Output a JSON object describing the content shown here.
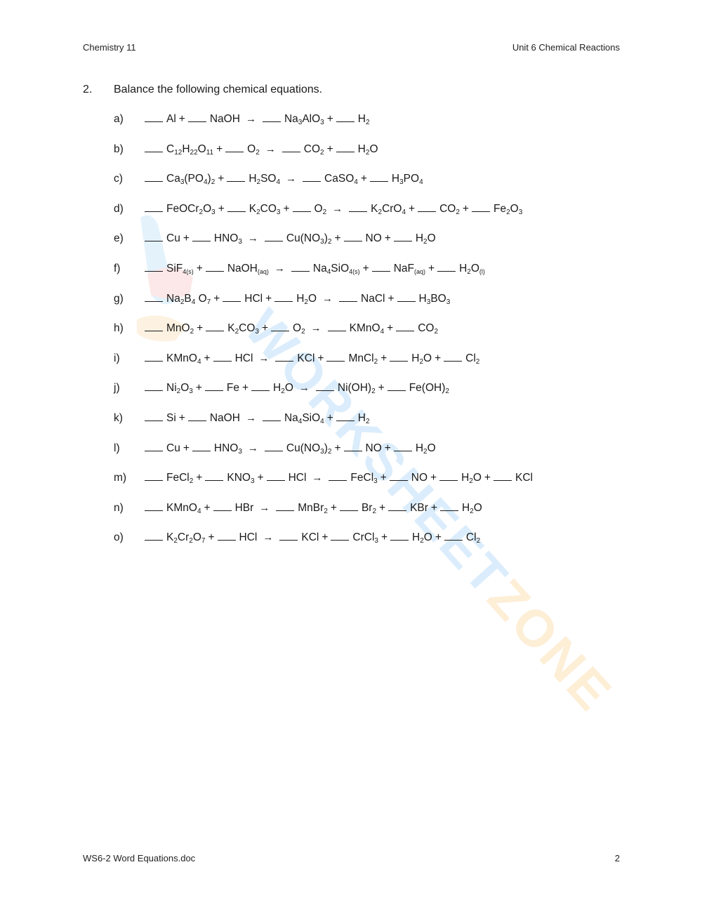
{
  "header": {
    "left": "Chemistry 11",
    "right": "Unit 6 Chemical Reactions"
  },
  "footer": {
    "left": "WS6-2 Word Equations.doc",
    "right": "2"
  },
  "question": {
    "number": "2.",
    "prompt": "Balance the following chemical equations."
  },
  "symbols": {
    "plus": "+",
    "arrow": "→"
  },
  "watermark": {
    "text": "WORKSHEETZONE",
    "colors": [
      "#cfe8fb",
      "#fbd6d6",
      "#fde9c9"
    ]
  },
  "equations": [
    {
      "label": "a)",
      "reactants": [
        [
          [
            "Al",
            ""
          ]
        ],
        [
          [
            "NaOH",
            ""
          ]
        ]
      ],
      "products": [
        [
          [
            "Na",
            "3"
          ],
          [
            "AlO",
            "3"
          ]
        ],
        [
          [
            "H",
            "2"
          ]
        ]
      ]
    },
    {
      "label": "b)",
      "reactants": [
        [
          [
            "C",
            "12"
          ],
          [
            "H",
            "22"
          ],
          [
            "O",
            "11"
          ]
        ],
        [
          [
            "O",
            "2"
          ]
        ]
      ],
      "products": [
        [
          [
            "CO",
            "2"
          ]
        ],
        [
          [
            "H",
            "2"
          ],
          [
            "O",
            ""
          ]
        ]
      ]
    },
    {
      "label": "c)",
      "reactants": [
        [
          [
            "Ca",
            "3"
          ],
          [
            "(PO",
            "4"
          ],
          [
            ")",
            "2"
          ]
        ],
        [
          [
            "H",
            "2"
          ],
          [
            "SO",
            "4"
          ]
        ]
      ],
      "products": [
        [
          [
            "CaSO",
            "4"
          ]
        ],
        [
          [
            "H",
            "3"
          ],
          [
            "PO",
            "4"
          ]
        ]
      ]
    },
    {
      "label": "d)",
      "reactants": [
        [
          [
            "FeOCr",
            "2"
          ],
          [
            "O",
            "3"
          ]
        ],
        [
          [
            "K",
            "2"
          ],
          [
            "CO",
            "3"
          ]
        ],
        [
          [
            "O",
            "2"
          ]
        ]
      ],
      "products": [
        [
          [
            "K",
            "2"
          ],
          [
            "CrO",
            "4"
          ]
        ],
        [
          [
            "CO",
            "2"
          ]
        ],
        [
          [
            "Fe",
            "2"
          ],
          [
            "O",
            "3"
          ]
        ]
      ]
    },
    {
      "label": "e)",
      "reactants": [
        [
          [
            "Cu",
            ""
          ]
        ],
        [
          [
            "HNO",
            "3"
          ]
        ]
      ],
      "products": [
        [
          [
            "Cu(NO",
            "3"
          ],
          [
            ")",
            "2"
          ]
        ],
        [
          [
            "NO",
            ""
          ]
        ],
        [
          [
            "H",
            "2"
          ],
          [
            "O",
            ""
          ]
        ]
      ]
    },
    {
      "label": "f)",
      "reactants": [
        [
          [
            "SiF",
            "4(s)"
          ]
        ],
        [
          [
            "NaOH",
            "(aq)"
          ]
        ]
      ],
      "products": [
        [
          [
            "Na",
            "4"
          ],
          [
            "SiO",
            "4(s)"
          ]
        ],
        [
          [
            "NaF",
            "(aq)"
          ]
        ],
        [
          [
            "H",
            "2"
          ],
          [
            "O",
            "(l)"
          ]
        ]
      ]
    },
    {
      "label": "g)",
      "reactants": [
        [
          [
            "Na",
            "2"
          ],
          [
            "B",
            "4"
          ],
          [
            " O",
            "7"
          ]
        ],
        [
          [
            "HCl",
            ""
          ]
        ],
        [
          [
            "H",
            "2"
          ],
          [
            "O",
            ""
          ]
        ]
      ],
      "products": [
        [
          [
            "NaCl",
            ""
          ]
        ],
        [
          [
            "H",
            "3"
          ],
          [
            "BO",
            "3"
          ]
        ]
      ]
    },
    {
      "label": "h)",
      "reactants": [
        [
          [
            "MnO",
            "2"
          ]
        ],
        [
          [
            "K",
            "2"
          ],
          [
            "CO",
            "3"
          ]
        ],
        [
          [
            "O",
            "2"
          ]
        ]
      ],
      "products": [
        [
          [
            "KMnO",
            "4"
          ]
        ],
        [
          [
            "CO",
            "2"
          ]
        ]
      ]
    },
    {
      "label": "i)",
      "reactants": [
        [
          [
            "KMnO",
            "4"
          ]
        ],
        [
          [
            "HCl",
            ""
          ]
        ]
      ],
      "products": [
        [
          [
            "KCl",
            ""
          ]
        ],
        [
          [
            "MnCl",
            "2"
          ]
        ],
        [
          [
            "H",
            "2"
          ],
          [
            "O",
            ""
          ]
        ],
        [
          [
            "Cl",
            "2"
          ]
        ]
      ]
    },
    {
      "label": "j)",
      "reactants": [
        [
          [
            "Ni",
            "2"
          ],
          [
            "O",
            "3"
          ]
        ],
        [
          [
            "Fe",
            ""
          ]
        ],
        [
          [
            "H",
            "2"
          ],
          [
            "O",
            ""
          ]
        ]
      ],
      "products": [
        [
          [
            "Ni(OH)",
            "2"
          ]
        ],
        [
          [
            "Fe(OH)",
            "2"
          ]
        ]
      ]
    },
    {
      "label": "k)",
      "reactants": [
        [
          [
            "Si",
            ""
          ]
        ],
        [
          [
            "NaOH",
            ""
          ]
        ]
      ],
      "products": [
        [
          [
            "Na",
            "4"
          ],
          [
            "SiO",
            "4"
          ]
        ],
        [
          [
            "H",
            "2"
          ]
        ]
      ]
    },
    {
      "label": "l)",
      "reactants": [
        [
          [
            "Cu",
            ""
          ]
        ],
        [
          [
            "HNO",
            "3"
          ]
        ]
      ],
      "products": [
        [
          [
            "Cu(NO",
            "3"
          ],
          [
            ")",
            "2"
          ]
        ],
        [
          [
            "NO",
            ""
          ]
        ],
        [
          [
            "H",
            "2"
          ],
          [
            "O",
            ""
          ]
        ]
      ]
    },
    {
      "label": "m)",
      "reactants": [
        [
          [
            "FeCl",
            "2"
          ]
        ],
        [
          [
            "KNO",
            "3"
          ]
        ],
        [
          [
            "HCl",
            ""
          ]
        ]
      ],
      "products": [
        [
          [
            "FeCl",
            "3"
          ]
        ],
        [
          [
            "NO",
            ""
          ]
        ],
        [
          [
            "H",
            "2"
          ],
          [
            "O",
            ""
          ]
        ],
        [
          [
            "KCl",
            ""
          ]
        ]
      ]
    },
    {
      "label": "n)",
      "reactants": [
        [
          [
            "KMnO",
            "4"
          ]
        ],
        [
          [
            "HBr",
            ""
          ]
        ]
      ],
      "products": [
        [
          [
            "MnBr",
            "2"
          ]
        ],
        [
          [
            "Br",
            "2"
          ]
        ],
        [
          [
            "KBr",
            ""
          ]
        ],
        [
          [
            "H",
            "2"
          ],
          [
            "O",
            ""
          ]
        ]
      ]
    },
    {
      "label": "o)",
      "reactants": [
        [
          [
            "K",
            "2"
          ],
          [
            "Cr",
            "2"
          ],
          [
            "O",
            "7"
          ]
        ],
        [
          [
            "HCl",
            ""
          ]
        ]
      ],
      "products": [
        [
          [
            "KCl",
            ""
          ]
        ],
        [
          [
            "CrCl",
            "3"
          ]
        ],
        [
          [
            "H",
            "2"
          ],
          [
            "O",
            ""
          ]
        ],
        [
          [
            "Cl",
            "2"
          ]
        ]
      ]
    }
  ]
}
